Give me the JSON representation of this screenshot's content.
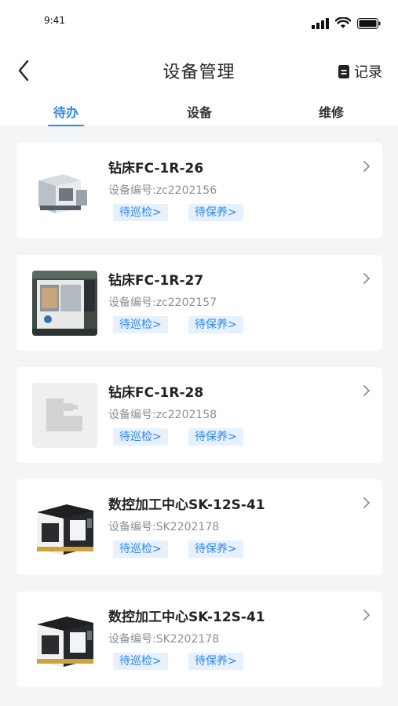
{
  "status_bar": {
    "time": "9:41"
  },
  "nav": {
    "title": "设备管理",
    "record_label": "记录"
  },
  "tabs": [
    {
      "label": "待办",
      "active": true
    },
    {
      "label": "设备",
      "active": false
    },
    {
      "label": "维修",
      "active": false
    }
  ],
  "colors": {
    "accent": "#2f86ea",
    "tag_bg": "#e6f1fd",
    "page_bg": "#f4f5f7",
    "secondary_text": "#8a8f99"
  },
  "devices": [
    {
      "name": "钻床FC-1R-26",
      "code": "设备编号:zc2202156",
      "inspect_label": "待巡检>",
      "maintain_label": "待保养>",
      "image": "drill-machine-photo"
    },
    {
      "name": "钻床FC-1R-27",
      "code": "设备编号:zc2202157",
      "inspect_label": "待巡检>",
      "maintain_label": "待保养>",
      "image": "machining-center-photo"
    },
    {
      "name": "钻床FC-1R-28",
      "code": "设备编号:zc2202158",
      "inspect_label": "待巡检>",
      "maintain_label": "待保养>",
      "image": "placeholder-machine-icon"
    },
    {
      "name": "数控加工中心SK-12S-41",
      "code": "设备编号:SK2202178",
      "inspect_label": "待巡检>",
      "maintain_label": "待保养>",
      "image": "cnc-center-photo"
    },
    {
      "name": "数控加工中心SK-12S-41",
      "code": "设备编号:SK2202178",
      "inspect_label": "待巡检>",
      "maintain_label": "待保养>",
      "image": "cnc-center-photo"
    }
  ]
}
